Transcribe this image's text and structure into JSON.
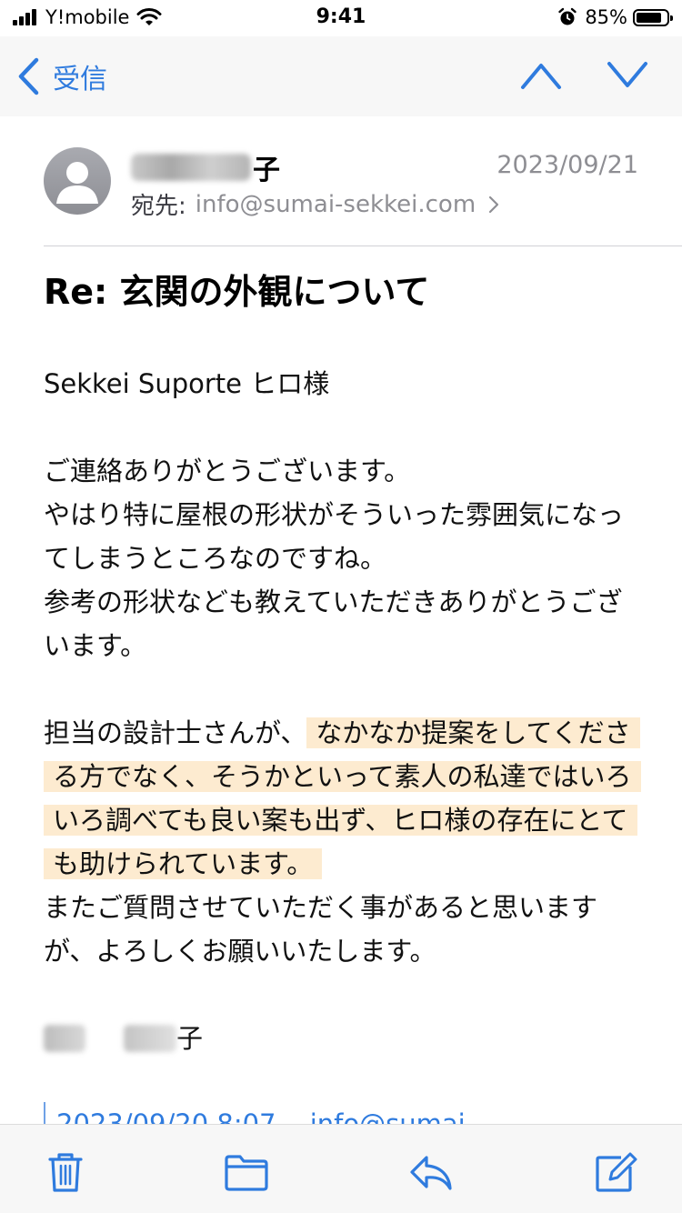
{
  "status": {
    "carrier": "Y!mobile",
    "time": "9:41",
    "battery_percent": "85%",
    "battery_level": 0.85
  },
  "nav": {
    "back_label": "受信"
  },
  "message": {
    "sender_suffix": "子",
    "date": "2023/09/21",
    "to_label": "宛先:",
    "to_email": "info@sumai-sekkei.com",
    "subject": "Re: 玄関の外観について",
    "greeting": "Sekkei Suporte ヒロ様",
    "para1": [
      "ご連絡ありがとうございます。",
      "やはり特に屋根の形状がそういった雰囲気になってしまうところなのですね。",
      "参考の形状なども教えていただきありがとうございます。"
    ],
    "para2_lead": "担当の設計士さんが、",
    "para2_highlight": "なかなか提案をしてくださる方でなく、そうかといって素人の私達ではいろいろ調べても良い案も出ず、ヒロ様の存在にとても助けられています。",
    "para2_tail": "またご質問させていただく事があると思いますが、よろしくお願いいたします。",
    "signature_suffix": "子",
    "quoted_date": "2023/09/20 8:07",
    "quoted_from": "info@sumai"
  },
  "colors": {
    "accent": "#2f7bde",
    "highlight": "#fdebd0",
    "secondary_text": "#8e8e93",
    "bar_bg": "#f7f7f7"
  },
  "icons": {
    "back": "chevron-left-icon",
    "previous": "chevron-up-icon",
    "next": "chevron-down-icon",
    "trash": "trash-icon",
    "move": "folder-icon",
    "reply": "reply-icon",
    "compose": "compose-icon"
  }
}
